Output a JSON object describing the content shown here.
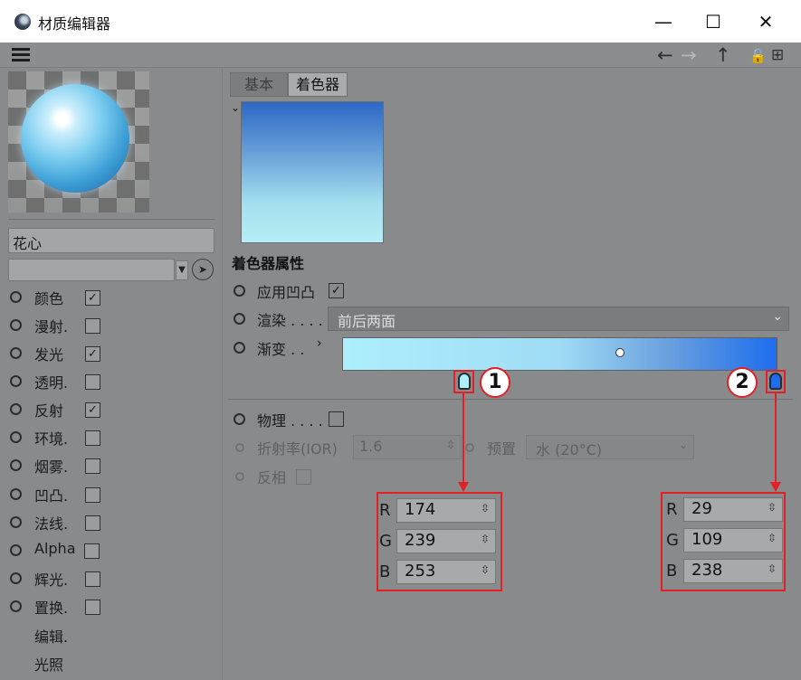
{
  "window": {
    "title": "材质编辑器",
    "min": "—",
    "max": "☐",
    "close": "✕"
  },
  "menubar": {
    "back": "←",
    "forward": "→",
    "up": "↑",
    "lock": "🔓",
    "new": "⊞"
  },
  "material": {
    "name": "花心",
    "dropdown_value": ""
  },
  "channels": [
    {
      "label": "颜色",
      "checked": true,
      "check": "✓"
    },
    {
      "label": "漫射.",
      "checked": false,
      "check": ""
    },
    {
      "label": "发光",
      "checked": true,
      "check": "✓"
    },
    {
      "label": "透明.",
      "checked": false,
      "check": ""
    },
    {
      "label": "反射",
      "checked": true,
      "check": "✓"
    },
    {
      "label": "环境.",
      "checked": false,
      "check": ""
    },
    {
      "label": "烟雾.",
      "checked": false,
      "check": ""
    },
    {
      "label": "凹凸.",
      "checked": false,
      "check": ""
    },
    {
      "label": "法线.",
      "checked": false,
      "check": ""
    },
    {
      "label": "Alpha",
      "checked": false,
      "check": ""
    },
    {
      "label": "辉光.",
      "checked": false,
      "check": ""
    },
    {
      "label": "置换.",
      "checked": false,
      "check": ""
    }
  ],
  "subitems": [
    "编辑.",
    "光照"
  ],
  "tabs": {
    "basic": "基本",
    "shader": "着色器"
  },
  "shader": {
    "section_title": "着色器属性",
    "apply_bump": "应用凹凸",
    "apply_bump_check": "✓",
    "render_label": "渲染 . . . .",
    "render_value": "前后两面",
    "gradient_label": "渐变 . .",
    "physical_label": "物理 . . . .",
    "ior_label": "折射率(IOR)",
    "ior_value": "1.6",
    "preset_label": "预置",
    "preset_value": "水 (20°C)",
    "invert_label": "反相"
  },
  "gradient": {
    "start_color": "#aeeffd",
    "end_color": "#1d6dee"
  },
  "callouts": [
    {
      "badge": "1",
      "r_label": "R",
      "r": "174",
      "g_label": "G",
      "g": "239",
      "b_label": "B",
      "b": "253"
    },
    {
      "badge": "2",
      "r_label": "R",
      "r": "29",
      "g_label": "G",
      "g": "109",
      "b_label": "B",
      "b": "238"
    }
  ],
  "colors": {
    "highlight": "#e41f26",
    "panel": "#888a8c"
  }
}
